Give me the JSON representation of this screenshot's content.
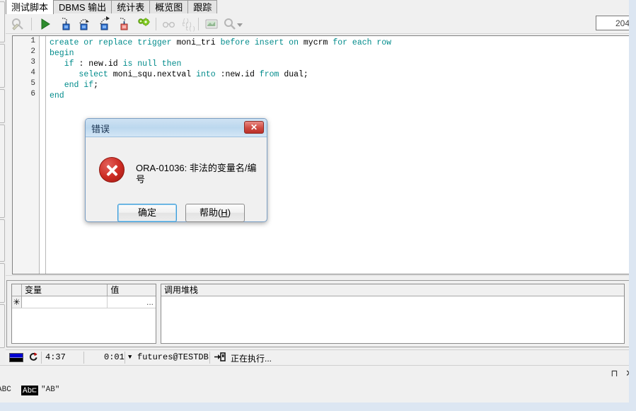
{
  "window": {
    "tabs": [
      {
        "label": "测试脚本",
        "active": true
      },
      {
        "label": "DBMS 输出",
        "active": false
      },
      {
        "label": "统计表",
        "active": false
      },
      {
        "label": "概览图",
        "active": false
      },
      {
        "label": "跟踪",
        "active": false
      }
    ]
  },
  "toolbar": {
    "buttons": [
      {
        "name": "find-debug-icon",
        "title": "查找"
      },
      {
        "name": "run-icon",
        "title": "运行"
      },
      {
        "name": "step-into-icon",
        "title": "单步进入"
      },
      {
        "name": "step-over-icon",
        "title": "单步跳过"
      },
      {
        "name": "step-out-icon",
        "title": "单步跳出"
      },
      {
        "name": "run-to-exception-icon",
        "title": "运行至异常"
      },
      {
        "name": "settings-gear-icon",
        "title": "设置"
      },
      {
        "name": "watch-glasses-icon",
        "title": "查看变量"
      },
      {
        "name": "call-stack-icon",
        "title": "调用堆栈"
      },
      {
        "name": "preview-icon",
        "title": "预览"
      },
      {
        "name": "zoom-icon",
        "title": "缩放"
      }
    ],
    "count_value": "204"
  },
  "editor": {
    "line_numbers": [
      "1",
      "2",
      "3",
      "4",
      "5",
      "6"
    ],
    "lines": [
      [
        {
          "t": "create or replace trigger ",
          "k": true
        },
        {
          "t": "moni_tri ",
          "k": false
        },
        {
          "t": "before insert on ",
          "k": true
        },
        {
          "t": "mycrm ",
          "k": false
        },
        {
          "t": "for each row",
          "k": true
        }
      ],
      [
        {
          "t": "begin",
          "k": true
        }
      ],
      [
        {
          "t": "   ",
          "k": false
        },
        {
          "t": "if ",
          "k": true
        },
        {
          "t": ": new.id ",
          "k": false
        },
        {
          "t": "is null then",
          "k": true
        }
      ],
      [
        {
          "t": "      ",
          "k": false
        },
        {
          "t": "select ",
          "k": true
        },
        {
          "t": "moni_squ.nextval ",
          "k": false
        },
        {
          "t": "into ",
          "k": true
        },
        {
          "t": ":new.id ",
          "k": false
        },
        {
          "t": "from ",
          "k": true
        },
        {
          "t": "dual;",
          "k": false
        }
      ],
      [
        {
          "t": "   ",
          "k": false
        },
        {
          "t": "end if",
          "k": true
        },
        {
          "t": ";",
          "k": false
        }
      ],
      [
        {
          "t": "end",
          "k": true
        }
      ]
    ]
  },
  "panels": {
    "variables": {
      "headers": [
        "",
        "变量",
        "值"
      ],
      "rows": [
        {
          "indicator": "✳",
          "variable": "",
          "value": "..."
        }
      ]
    },
    "call_stack": {
      "header": "调用堆栈",
      "rows": []
    }
  },
  "statusbar": {
    "flag_icon": "flag-icon",
    "refresh_icon": "refresh-icon",
    "elapsed_total": "4:37",
    "elapsed_step": "0:01",
    "dropdown_icon": "▼",
    "connection": "futures@TESTDB",
    "connect_icon": "connection-icon",
    "message": "正在执行..."
  },
  "pinbar": {
    "pin_icon": "⊓",
    "close_icon": "✕"
  },
  "ime": {
    "items": [
      "ABC",
      "Ab⊏",
      "\"AB\""
    ]
  },
  "dialog": {
    "title": "错误",
    "close_label": "✕",
    "icon": "error-icon",
    "message": "ORA-01036: 非法的变量名/编号",
    "ok_label": "确定",
    "help_label_pre": "帮助(",
    "help_label_key": "H",
    "help_label_post": ")"
  },
  "colors": {
    "keyword": "#008b8b",
    "error_red": "#cc2a22",
    "dialog_title": "#bcd8ee",
    "accent_blue": "#3c9bd8"
  }
}
